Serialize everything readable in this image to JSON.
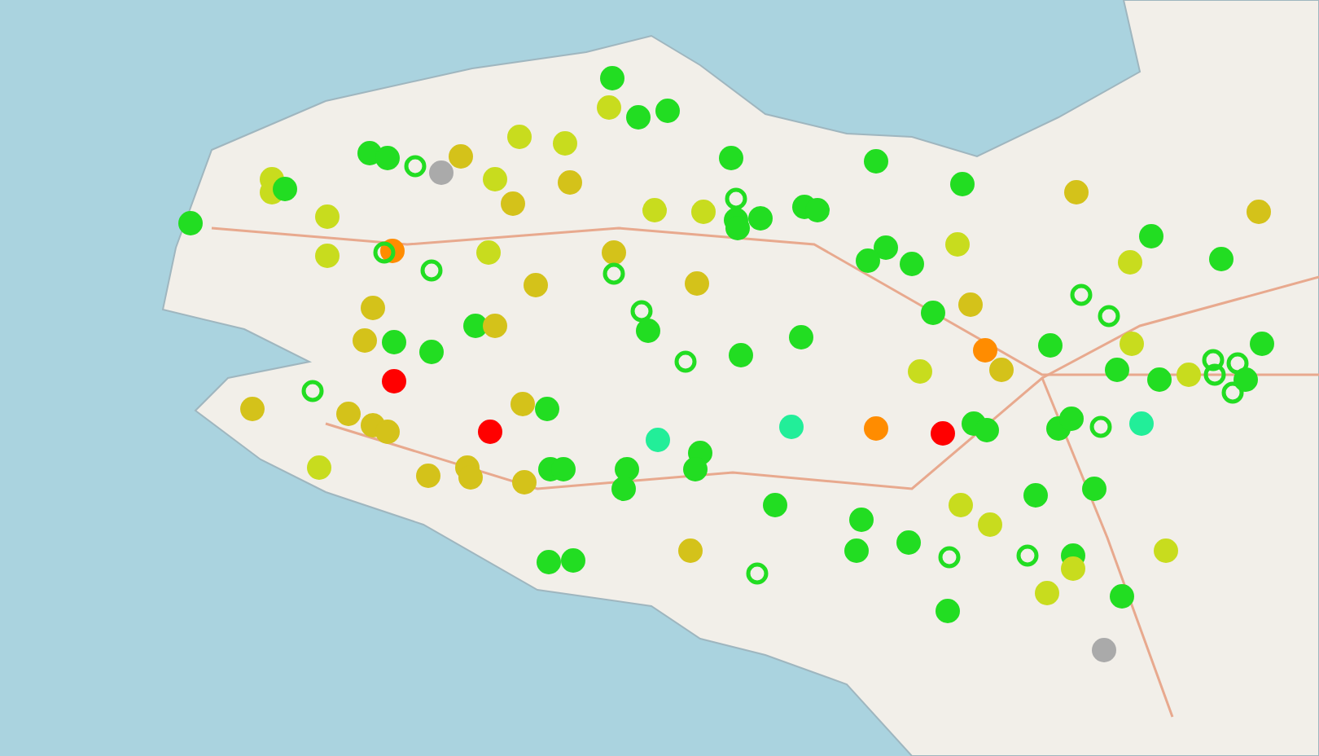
{
  "map": {
    "markers": [
      {
        "kind": "dot",
        "color": "#22dd22"
      },
      {
        "kind": "dot",
        "color": "#c8dc1e"
      },
      {
        "kind": "dot",
        "color": "#22dd22"
      },
      {
        "kind": "dot",
        "color": "#22dd22"
      },
      {
        "kind": "dot",
        "color": "#c8dc1e"
      },
      {
        "kind": "dot",
        "color": "#c8dc1e"
      },
      {
        "kind": "dot",
        "color": "#22dd22"
      },
      {
        "kind": "dot",
        "color": "#22dd22"
      },
      {
        "kind": "ring",
        "color": "#22dd22"
      },
      {
        "kind": "dot",
        "color": "#aaaaaa"
      },
      {
        "kind": "dot",
        "color": "#d4c21a"
      },
      {
        "kind": "dot",
        "color": "#c8dc1e"
      },
      {
        "kind": "dot",
        "color": "#c8dc1e"
      },
      {
        "kind": "dot",
        "color": "#c8dc1e"
      },
      {
        "kind": "dot",
        "color": "#22dd22"
      },
      {
        "kind": "dot",
        "color": "#22dd22"
      },
      {
        "kind": "dot",
        "color": "#c8dc1e"
      },
      {
        "kind": "dot",
        "color": "#d4c21a"
      },
      {
        "kind": "dot",
        "color": "#d4c21a"
      },
      {
        "kind": "dot",
        "color": "#22dd22"
      },
      {
        "kind": "dot",
        "color": "#22dd22"
      },
      {
        "kind": "ring",
        "color": "#22dd22"
      },
      {
        "kind": "dot",
        "color": "#c8dc1e"
      },
      {
        "kind": "dot",
        "color": "#c8dc1e"
      },
      {
        "kind": "dot",
        "color": "#22dd22"
      },
      {
        "kind": "dot",
        "color": "#22dd22"
      },
      {
        "kind": "dot",
        "color": "#22dd22"
      },
      {
        "kind": "dot",
        "color": "#22dd22"
      },
      {
        "kind": "dot",
        "color": "#22dd22"
      },
      {
        "kind": "dot",
        "color": "#22dd22"
      },
      {
        "kind": "dot",
        "color": "#d4c21a"
      },
      {
        "kind": "dot",
        "color": "#d4c21a"
      },
      {
        "kind": "dot",
        "color": "#ff8c00"
      },
      {
        "kind": "ring",
        "color": "#22dd22"
      },
      {
        "kind": "ring",
        "color": "#22dd22"
      },
      {
        "kind": "dot",
        "color": "#c8dc1e"
      },
      {
        "kind": "dot",
        "color": "#c8dc1e"
      },
      {
        "kind": "dot",
        "color": "#d4c21a"
      },
      {
        "kind": "ring",
        "color": "#22dd22"
      },
      {
        "kind": "dot",
        "color": "#d4c21a"
      },
      {
        "kind": "dot",
        "color": "#d4c21a"
      },
      {
        "kind": "dot",
        "color": "#22dd22"
      },
      {
        "kind": "dot",
        "color": "#22dd22"
      },
      {
        "kind": "dot",
        "color": "#22dd22"
      },
      {
        "kind": "dot",
        "color": "#c8dc1e"
      },
      {
        "kind": "dot",
        "color": "#22dd22"
      },
      {
        "kind": "dot",
        "color": "#c8dc1e"
      },
      {
        "kind": "dot",
        "color": "#22dd22"
      },
      {
        "kind": "dot",
        "color": "#d4c21a"
      },
      {
        "kind": "ring",
        "color": "#22dd22"
      },
      {
        "kind": "dot",
        "color": "#22dd22"
      },
      {
        "kind": "dot",
        "color": "#22dd22"
      },
      {
        "kind": "dot",
        "color": "#d4c21a"
      },
      {
        "kind": "dot",
        "color": "#d4c21a"
      },
      {
        "kind": "dot",
        "color": "#22dd22"
      },
      {
        "kind": "dot",
        "color": "#22dd22"
      },
      {
        "kind": "ring",
        "color": "#22dd22"
      },
      {
        "kind": "dot",
        "color": "#22dd22"
      },
      {
        "kind": "dot",
        "color": "#22dd22"
      },
      {
        "kind": "dot",
        "color": "#22dd22"
      },
      {
        "kind": "dot",
        "color": "#d4c21a"
      },
      {
        "kind": "ring",
        "color": "#22dd22"
      },
      {
        "kind": "ring",
        "color": "#22dd22"
      },
      {
        "kind": "dot",
        "color": "#ff0000"
      },
      {
        "kind": "ring",
        "color": "#22dd22"
      },
      {
        "kind": "dot",
        "color": "#d4c21a"
      },
      {
        "kind": "dot",
        "color": "#d4c21a"
      },
      {
        "kind": "dot",
        "color": "#d4c21a"
      },
      {
        "kind": "dot",
        "color": "#d4c21a"
      },
      {
        "kind": "dot",
        "color": "#ff0000"
      },
      {
        "kind": "dot",
        "color": "#d4c21a"
      },
      {
        "kind": "dot",
        "color": "#22dd22"
      },
      {
        "kind": "dot",
        "color": "#22ee99"
      },
      {
        "kind": "dot",
        "color": "#22dd22"
      },
      {
        "kind": "dot",
        "color": "#22dd22"
      },
      {
        "kind": "dot",
        "color": "#22ee99"
      },
      {
        "kind": "dot",
        "color": "#ff8c00"
      },
      {
        "kind": "dot",
        "color": "#ff0000"
      },
      {
        "kind": "dot",
        "color": "#22dd22"
      },
      {
        "kind": "dot",
        "color": "#22dd22"
      },
      {
        "kind": "dot",
        "color": "#c8dc1e"
      },
      {
        "kind": "dot",
        "color": "#ff8c00"
      },
      {
        "kind": "dot",
        "color": "#d4c21a"
      },
      {
        "kind": "dot",
        "color": "#22dd22"
      },
      {
        "kind": "dot",
        "color": "#22dd22"
      },
      {
        "kind": "dot",
        "color": "#22dd22"
      },
      {
        "kind": "ring",
        "color": "#22dd22"
      },
      {
        "kind": "dot",
        "color": "#22ee99"
      },
      {
        "kind": "dot",
        "color": "#22dd22"
      },
      {
        "kind": "dot",
        "color": "#22dd22"
      },
      {
        "kind": "dot",
        "color": "#c8dc1e"
      },
      {
        "kind": "dot",
        "color": "#c8dc1e"
      },
      {
        "kind": "ring",
        "color": "#22dd22"
      },
      {
        "kind": "ring",
        "color": "#22dd22"
      },
      {
        "kind": "ring",
        "color": "#22dd22"
      },
      {
        "kind": "ring",
        "color": "#22dd22"
      },
      {
        "kind": "dot",
        "color": "#22dd22"
      },
      {
        "kind": "dot",
        "color": "#22dd22"
      },
      {
        "kind": "dot",
        "color": "#c8dc1e"
      },
      {
        "kind": "dot",
        "color": "#d4c21a"
      },
      {
        "kind": "dot",
        "color": "#d4c21a"
      },
      {
        "kind": "dot",
        "color": "#d4c21a"
      },
      {
        "kind": "dot",
        "color": "#d4c21a"
      },
      {
        "kind": "dot",
        "color": "#22dd22"
      },
      {
        "kind": "dot",
        "color": "#22dd22"
      },
      {
        "kind": "dot",
        "color": "#22dd22"
      },
      {
        "kind": "dot",
        "color": "#22dd22"
      },
      {
        "kind": "dot",
        "color": "#22dd22"
      },
      {
        "kind": "dot",
        "color": "#22dd22"
      },
      {
        "kind": "dot",
        "color": "#c8dc1e"
      },
      {
        "kind": "dot",
        "color": "#c8dc1e"
      },
      {
        "kind": "dot",
        "color": "#22dd22"
      },
      {
        "kind": "dot",
        "color": "#22dd22"
      },
      {
        "kind": "dot",
        "color": "#22dd22"
      },
      {
        "kind": "dot",
        "color": "#22dd22"
      },
      {
        "kind": "ring",
        "color": "#22dd22"
      },
      {
        "kind": "ring",
        "color": "#22dd22"
      },
      {
        "kind": "dot",
        "color": "#22dd22"
      },
      {
        "kind": "dot",
        "color": "#c8dc1e"
      },
      {
        "kind": "dot",
        "color": "#c8dc1e"
      },
      {
        "kind": "dot",
        "color": "#22dd22"
      },
      {
        "kind": "dot",
        "color": "#22dd22"
      },
      {
        "kind": "dot",
        "color": "#d4c21a"
      },
      {
        "kind": "ring",
        "color": "#22dd22"
      },
      {
        "kind": "dot",
        "color": "#c8dc1e"
      },
      {
        "kind": "dot",
        "color": "#22dd22"
      },
      {
        "kind": "dot",
        "color": "#22dd22"
      },
      {
        "kind": "dot",
        "color": "#aaaaaa"
      }
    ]
  }
}
